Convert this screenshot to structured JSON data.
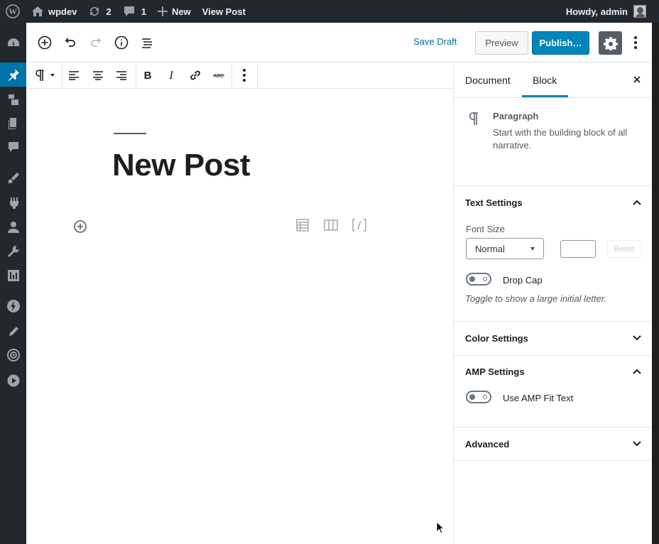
{
  "admin_bar": {
    "site_name": "wpdev",
    "updates_count": "2",
    "comments_count": "1",
    "new_label": "New",
    "view_post_label": "View Post",
    "greeting": "Howdy, admin"
  },
  "header": {
    "save_draft": "Save Draft",
    "preview": "Preview",
    "publish": "Publish…"
  },
  "post": {
    "title": "New Post"
  },
  "sidebar": {
    "tabs": [
      "Document",
      "Block"
    ],
    "active_tab": "Block",
    "block_card": {
      "title": "Paragraph",
      "description": "Start with the building block of all narrative."
    },
    "text_settings": {
      "title": "Text Settings",
      "font_size_label": "Font Size",
      "font_size_value": "Normal",
      "custom_size_value": "",
      "reset_label": "Reset",
      "drop_cap_label": "Drop Cap",
      "drop_cap_help": "Toggle to show a large initial letter."
    },
    "color_settings": {
      "title": "Color Settings"
    },
    "amp_settings": {
      "title": "AMP Settings",
      "fit_text_label": "Use AMP Fit Text"
    },
    "advanced": {
      "title": "Advanced"
    }
  },
  "colors": {
    "admin_bar_bg": "#23282d",
    "active_menu": "#0073aa",
    "primary": "#0085ba",
    "link": "#0071a1"
  }
}
